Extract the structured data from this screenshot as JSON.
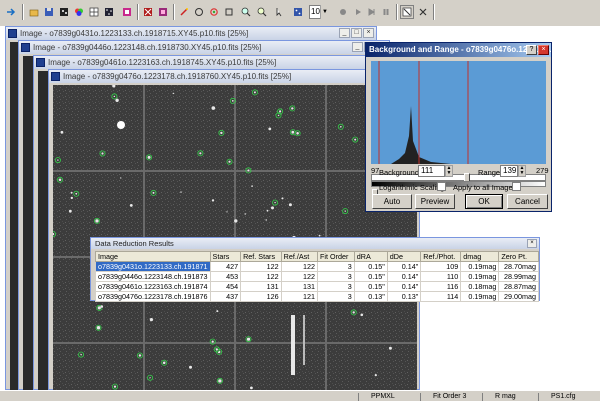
{
  "toolbar": {
    "zoom_value": "10",
    "buttons": [
      "arrow-icon",
      "folder-open-icon",
      "save-icon",
      "image-icon",
      "color-icon",
      "grid-icon",
      "stars-icon",
      "color-swap-icon",
      "filter-icon",
      "picker-icon",
      "circle-icon",
      "refresh-icon",
      "rect-icon",
      "zoom-in-icon",
      "zoom-out-icon",
      "dice-icon",
      "record-icon",
      "play-icon",
      "play-end-icon",
      "pause-icon",
      "stop-icon",
      "panel-icon",
      "cross-icon"
    ]
  },
  "windows": [
    {
      "title": "Image - o7839g0431o.1223133.ch.1918715.XY45.p10.fits [25%]"
    },
    {
      "title": "Image - o7839g0446o.1223148.ch.1918730.XY45.p10.fits [25%]"
    },
    {
      "title": "Image - o7839g0461o.1223163.ch.1918745.XY45.p10.fits [25%]"
    },
    {
      "title": "Image - o7839g0476o.1223178.ch.1918760.XY45.p10.fits [25%]"
    }
  ],
  "range_dialog": {
    "title": "Background and Range - o7839g0476o.1223178....",
    "hist_min": "97",
    "hist_max": "279",
    "background_label": "Background",
    "background_value": "111",
    "range_label": "Range",
    "range_value": "139",
    "log_scaling_label": "Logarithmic Scaling",
    "apply_all_label": "Apply to all Images",
    "auto_label": "Auto",
    "preview_label": "Preview",
    "ok_label": "OK",
    "cancel_label": "Cancel"
  },
  "results": {
    "title": "Data Reduction Results",
    "columns": [
      "Image",
      "Stars",
      "Ref. Stars",
      "Ref./Ast",
      "Fit Order",
      "dRA",
      "dDe",
      "Ref./Phot.",
      "dmag",
      "Zero Pt."
    ],
    "rows": [
      [
        "o7839g0431o.1223133.ch.191871",
        "427",
        "122",
        "122",
        "3",
        "0.15\"",
        "0.14\"",
        "109",
        "0.19mag",
        "28.70mag"
      ],
      [
        "o7839g0446o.1223148.ch.191873",
        "453",
        "122",
        "122",
        "3",
        "0.15\"",
        "0.14\"",
        "110",
        "0.19mag",
        "28.99mag"
      ],
      [
        "o7839g0461o.1223163.ch.191874",
        "454",
        "131",
        "131",
        "3",
        "0.15\"",
        "0.14\"",
        "116",
        "0.18mag",
        "28.87mag"
      ],
      [
        "o7839g0476o.1223178.ch.191876",
        "437",
        "126",
        "121",
        "3",
        "0.13\"",
        "0.13\"",
        "114",
        "0.19mag",
        "29.00mag"
      ]
    ]
  },
  "status": {
    "panels": [
      "PPMXL",
      "Fit Order 3",
      "R mag",
      "PS1.cfg"
    ]
  }
}
